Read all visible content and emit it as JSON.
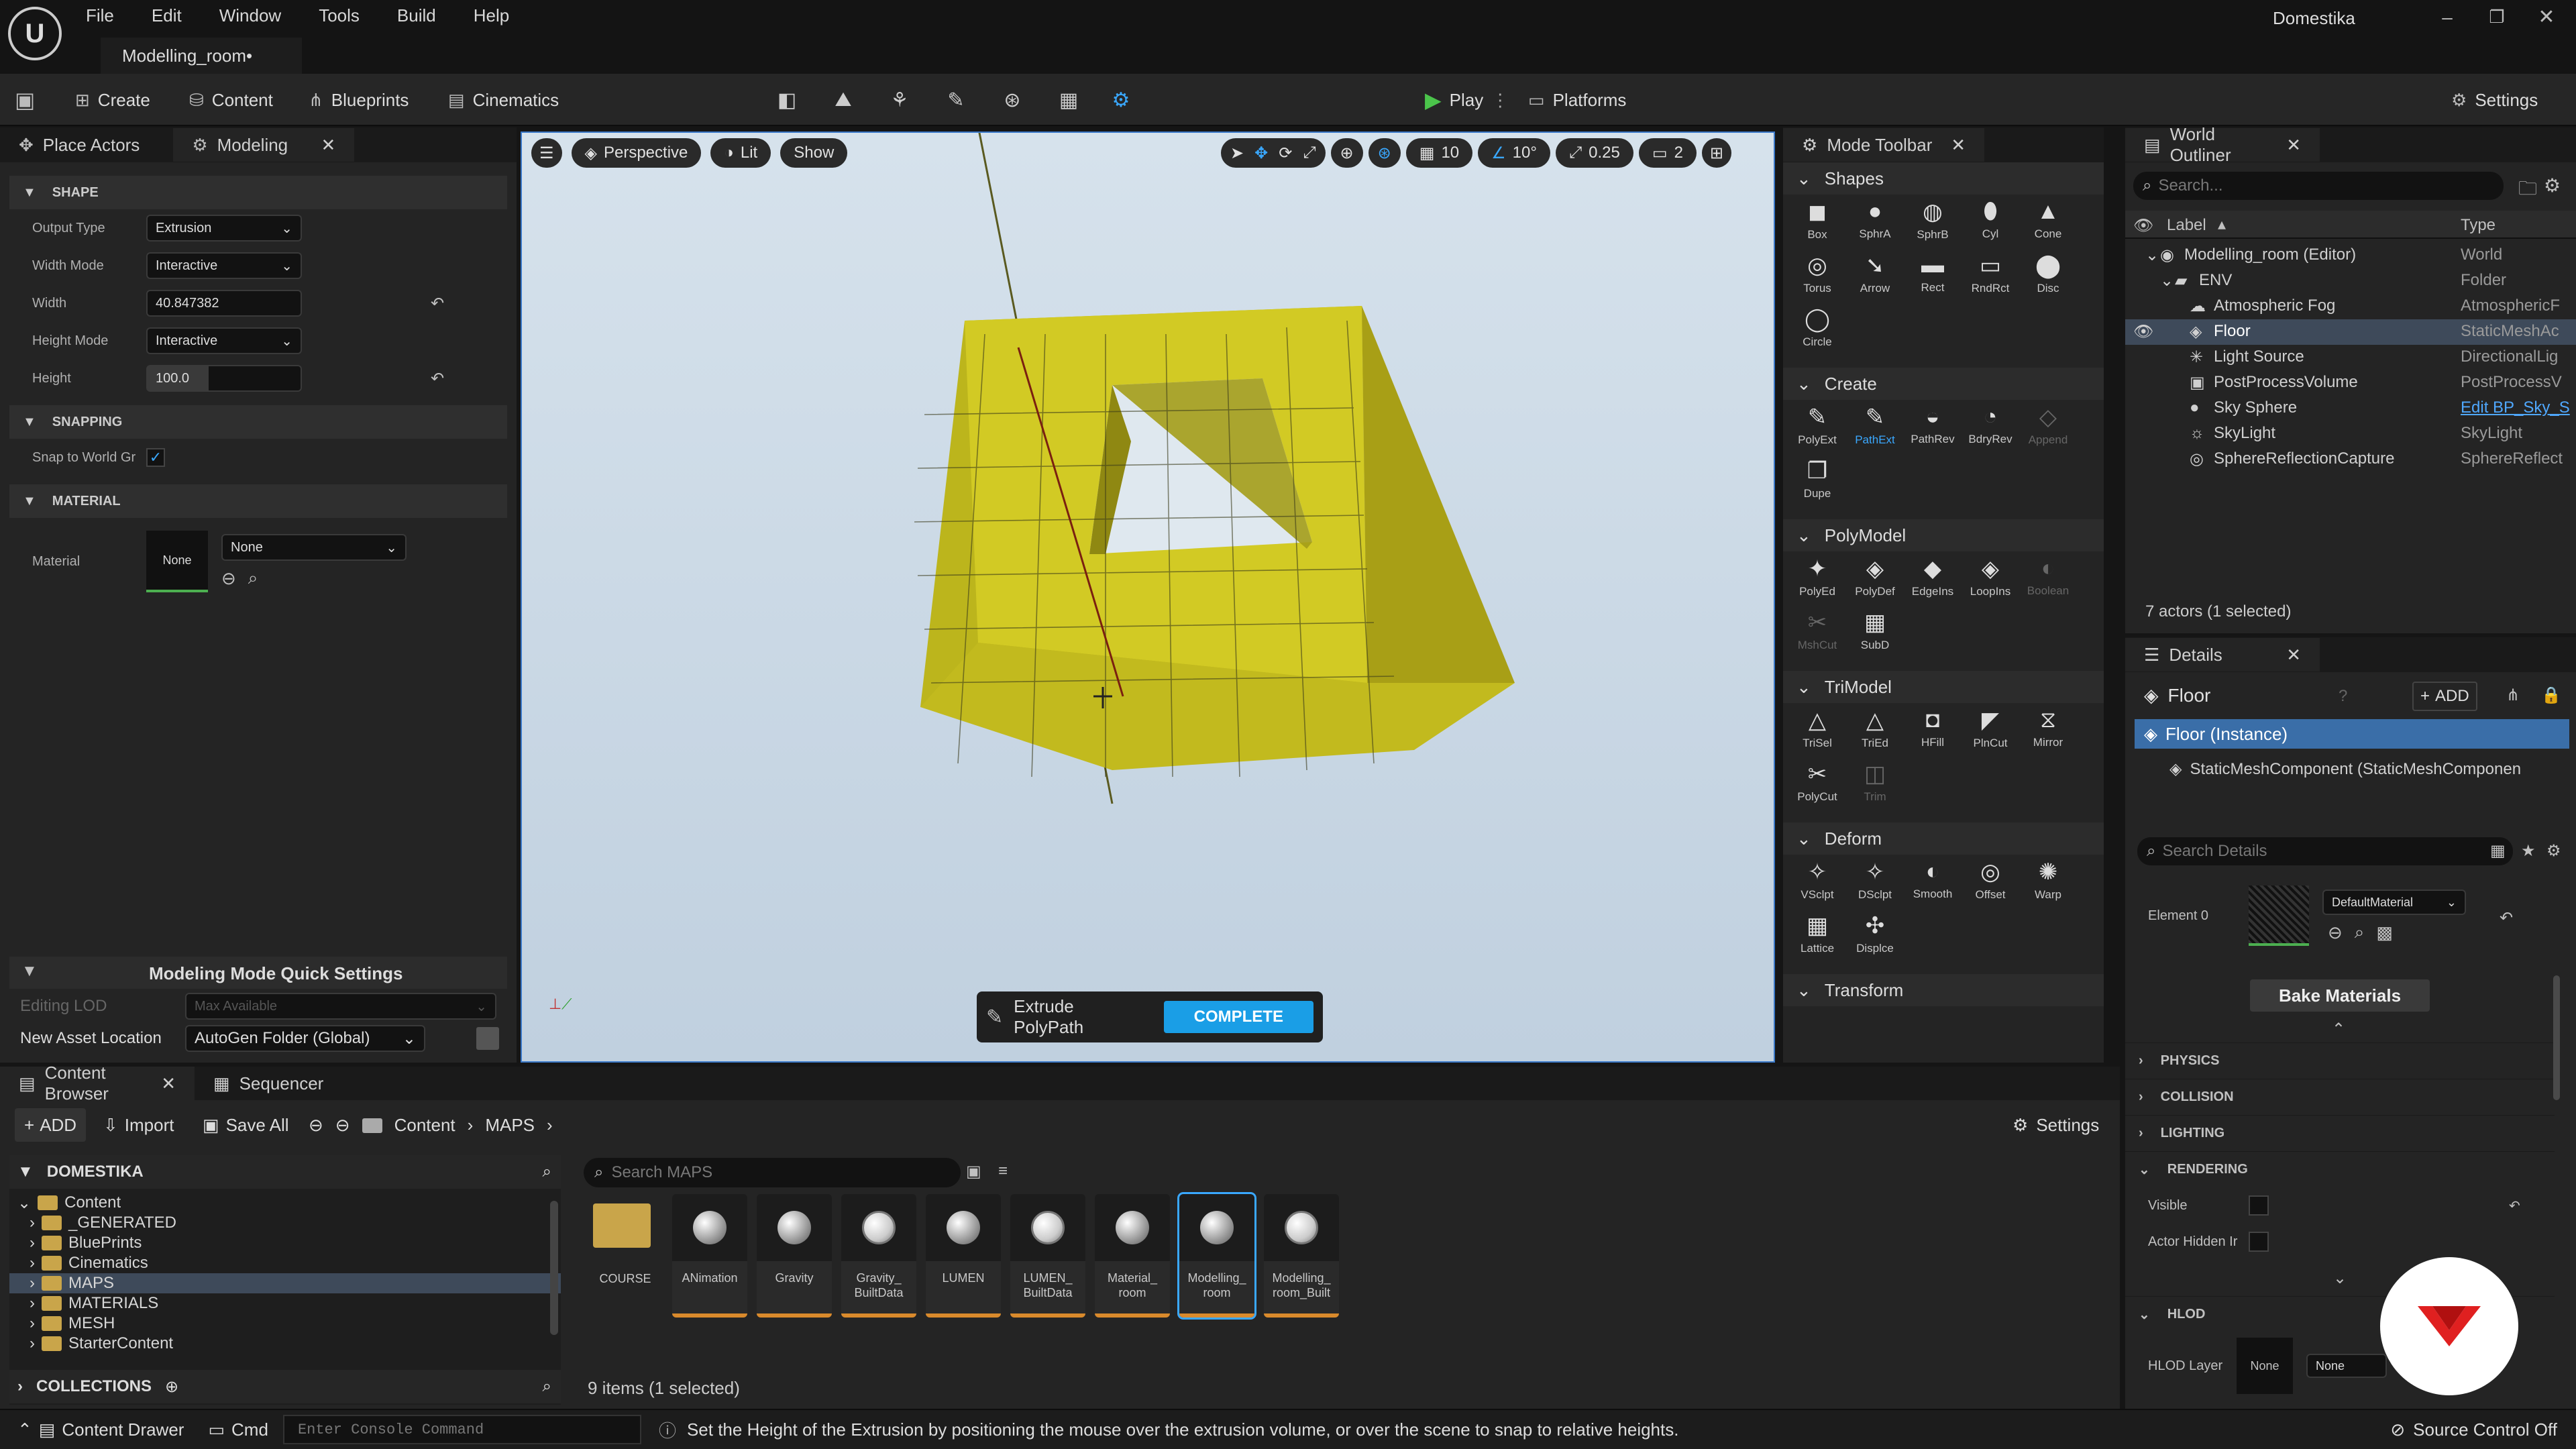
{
  "title_bar": {
    "menu": [
      "File",
      "Edit",
      "Window",
      "Tools",
      "Build",
      "Help"
    ],
    "level_tab": "Modelling_room•",
    "project": "Domestika"
  },
  "toolbar": {
    "create": "Create",
    "content": "Content",
    "blueprints": "Blueprints",
    "cinematics": "Cinematics",
    "play": "Play",
    "platforms": "Platforms",
    "settings": "Settings"
  },
  "left_panel": {
    "tab_place": "Place Actors",
    "tab_modeling": "Modeling",
    "shape_section": "SHAPE",
    "output_type_label": "Output Type",
    "output_type_value": "Extrusion",
    "width_mode_label": "Width Mode",
    "width_mode_value": "Interactive",
    "width_label": "Width",
    "width_value": "40.847382",
    "height_mode_label": "Height Mode",
    "height_mode_value": "Interactive",
    "height_label": "Height",
    "height_value": "100.0",
    "snapping_section": "SNAPPING",
    "snap_label": "Snap to World Gr",
    "material_section": "MATERIAL",
    "material_label": "Material",
    "material_thumb": "None",
    "material_value": "None",
    "quick_settings": "Modeling Mode Quick Settings",
    "editing_lod_label": "Editing LOD",
    "editing_lod_value": "Max Available",
    "new_asset_label": "New Asset Location",
    "new_asset_value": "AutoGen Folder (Global)"
  },
  "viewport": {
    "perspective": "Perspective",
    "lit": "Lit",
    "show": "Show",
    "grid_snap": "10",
    "rot_snap": "10°",
    "scale_snap": "0.25",
    "cam_speed": "2",
    "tool_name": "Extrude PolyPath",
    "complete": "COMPLETE"
  },
  "mode_toolbar": {
    "title": "Mode Toolbar",
    "categories": [
      {
        "name": "Shapes",
        "items": [
          "Box",
          "SphrA",
          "SphrB",
          "Cyl",
          "Cone",
          "Torus",
          "Arrow",
          "Rect",
          "RndRct",
          "Disc",
          "Circle"
        ]
      },
      {
        "name": "Create",
        "items": [
          "PolyExt",
          "PathExt",
          "PathRev",
          "BdryRev",
          "Append",
          "Dupe"
        ]
      },
      {
        "name": "PolyModel",
        "items": [
          "PolyEd",
          "PolyDef",
          "EdgeIns",
          "LoopIns",
          "Boolean",
          "MshCut",
          "SubD"
        ]
      },
      {
        "name": "TriModel",
        "items": [
          "TriSel",
          "TriEd",
          "HFill",
          "PlnCut",
          "Mirror",
          "PolyCut",
          "Trim"
        ]
      },
      {
        "name": "Deform",
        "items": [
          "VSclpt",
          "DSclpt",
          "Smooth",
          "Offset",
          "Warp",
          "Lattice",
          "Displce"
        ]
      },
      {
        "name": "Transform",
        "items": []
      }
    ]
  },
  "outliner": {
    "title": "World Outliner",
    "search_placeholder": "Search...",
    "col_label": "Label",
    "col_type": "Type",
    "rows": [
      {
        "label": "Modelling_room (Editor)",
        "type": "World"
      },
      {
        "label": "ENV",
        "type": "Folder"
      },
      {
        "label": "Atmospheric Fog",
        "type": "AtmosphericF"
      },
      {
        "label": "Floor",
        "type": "StaticMeshAc"
      },
      {
        "label": "Light Source",
        "type": "DirectionalLig"
      },
      {
        "label": "PostProcessVolume",
        "type": "PostProcessV"
      },
      {
        "label": "Sky Sphere",
        "type": "Edit BP_Sky_S"
      },
      {
        "label": "SkyLight",
        "type": "SkyLight"
      },
      {
        "label": "SphereReflectionCapture",
        "type": "SphereReflect"
      }
    ],
    "status": "7 actors (1 selected)"
  },
  "details": {
    "title": "Details",
    "actor": "Floor",
    "add": "ADD",
    "instance": "Floor (Instance)",
    "component": "StaticMeshComponent (StaticMeshComponen",
    "search_placeholder": "Search Details",
    "element_label": "Element 0",
    "element_value": "DefaultMaterial",
    "bake": "Bake Materials",
    "sections": [
      "PHYSICS",
      "COLLISION",
      "LIGHTING",
      "RENDERING"
    ],
    "visible_label": "Visible",
    "hidden_label": "Actor Hidden Ir",
    "hlod": "HLOD",
    "hlod_layer_label": "HLOD Layer",
    "hlod_thumb": "None",
    "hlod_value": "None"
  },
  "content_browser": {
    "tab": "Content Browser",
    "tab_seq": "Sequencer",
    "add": "ADD",
    "import": "Import",
    "save_all": "Save All",
    "crumb_content": "Content",
    "crumb_maps": "MAPS",
    "settings": "Settings",
    "project_root": "DOMESTIKA",
    "tree": [
      "Content",
      "_GENERATED",
      "BluePrints",
      "Cinematics",
      "MAPS",
      "MATERIALS",
      "MESH",
      "StarterContent"
    ],
    "collections": "COLLECTIONS",
    "search_placeholder": "Search MAPS",
    "assets": [
      {
        "name": "COURSE",
        "kind": "folder"
      },
      {
        "name": "ANimation",
        "kind": "map"
      },
      {
        "name": "Gravity",
        "kind": "map"
      },
      {
        "name": "Gravity_ BuiltData",
        "kind": "data"
      },
      {
        "name": "LUMEN",
        "kind": "map"
      },
      {
        "name": "LUMEN_ BuiltData",
        "kind": "data"
      },
      {
        "name": "Material_ room",
        "kind": "map"
      },
      {
        "name": "Modelling_ room",
        "kind": "map"
      },
      {
        "name": "Modelling_ room_Built",
        "kind": "data"
      }
    ],
    "count": "9 items (1 selected)"
  },
  "status_bar": {
    "drawer": "Content Drawer",
    "cmd": "Cmd",
    "console_placeholder": "Enter Console Command",
    "hint": "Set the Height of the Extrusion by positioning the mouse over the extrusion volume, or over the scene to snap to relative heights.",
    "source_control": "Source Control Off"
  },
  "colors": {
    "accent": "#1a9ee6",
    "mesh": "#d8d022",
    "watermark": "#e02020"
  }
}
